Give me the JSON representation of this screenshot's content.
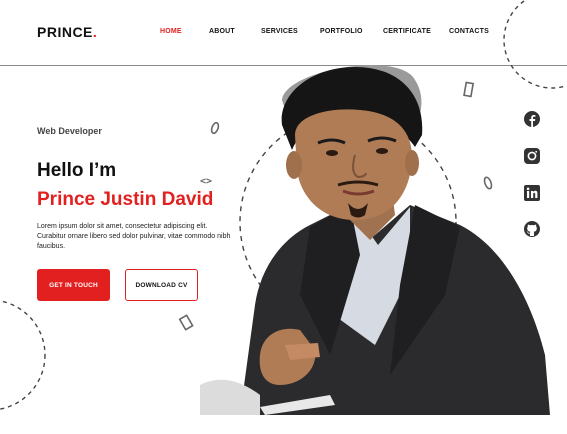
{
  "brand": {
    "name": "PRINCE",
    "dot": "."
  },
  "nav": {
    "items": [
      {
        "label": "HOME",
        "active": true
      },
      {
        "label": "ABOUT",
        "active": false
      },
      {
        "label": "SERVICES",
        "active": false
      },
      {
        "label": "PORTFOLIO",
        "active": false
      },
      {
        "label": "CERTIFICATE",
        "active": false
      },
      {
        "label": "CONTACTS",
        "active": false
      }
    ]
  },
  "hero": {
    "role": "Web Developer",
    "greeting": "Hello I’m",
    "name": "Prince Justin David",
    "description": "Lorem ipsum dolor sit amet, consectetur adipiscing elit. Curabitur ornare libero sed dolor pulvinar, vitae commodo nibh faucibus.",
    "primary_button": "GET IN TOUCH",
    "secondary_button": "DOWNLOAD CV"
  },
  "social": [
    {
      "icon": "facebook-icon"
    },
    {
      "icon": "instagram-icon"
    },
    {
      "icon": "linkedin-icon"
    },
    {
      "icon": "github-icon"
    }
  ],
  "decor": {
    "code_glyph": "<>"
  },
  "colors": {
    "accent": "#e32020",
    "text": "#111111",
    "background": "#ffffff"
  }
}
